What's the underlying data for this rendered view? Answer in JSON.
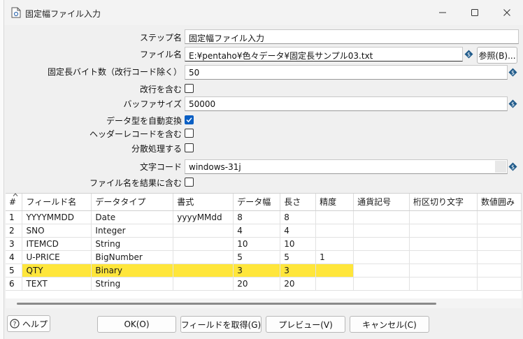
{
  "window": {
    "title": "固定幅ファイル入力"
  },
  "form": {
    "step_name_label": "ステップ名",
    "step_name_value": "固定幅ファイル入力",
    "filename_label": "ファイル名",
    "filename_value": "E:¥pentaho¥色々データ¥固定長サンプル03.txt",
    "browse_label": "参照(B)...",
    "line_width_label": "固定長バイト数（改行コード除く）",
    "line_width_value": "50",
    "line_feed_label": "改行を含む",
    "line_feed_checked": false,
    "buffer_label": "バッファサイズ",
    "buffer_value": "50000",
    "lazy_conv_label": "データ型を自動変換",
    "lazy_conv_checked": true,
    "header_label": "ヘッダーレコードを含む",
    "header_checked": false,
    "parallel_label": "分散処理する",
    "parallel_checked": false,
    "encoding_label": "文字コード",
    "encoding_value": "windows-31j",
    "add_filename_label": "ファイル名を結果に含む",
    "add_filename_checked": false
  },
  "grid": {
    "columns": [
      "#",
      "フィールド名",
      "データタイプ",
      "書式",
      "データ幅",
      "長さ",
      "精度",
      "通貨記号",
      "桁区切り文字",
      "数値囲み"
    ],
    "rows": [
      {
        "n": "1",
        "name": "YYYYMMDD",
        "type": "Date",
        "format": "yyyyMMdd",
        "width": "8",
        "length": "8",
        "precision": "",
        "highlight": false
      },
      {
        "n": "2",
        "name": "SNO",
        "type": "Integer",
        "format": "",
        "width": "4",
        "length": "4",
        "precision": "",
        "highlight": false
      },
      {
        "n": "3",
        "name": "ITEMCD",
        "type": "String",
        "format": "",
        "width": "10",
        "length": "10",
        "precision": "",
        "highlight": false
      },
      {
        "n": "4",
        "name": "U-PRICE",
        "type": "BigNumber",
        "format": "",
        "width": "5",
        "length": "5",
        "precision": "1",
        "highlight": false
      },
      {
        "n": "5",
        "name": "QTY",
        "type": "Binary",
        "format": "",
        "width": "3",
        "length": "3",
        "precision": "",
        "highlight": true
      },
      {
        "n": "6",
        "name": "TEXT",
        "type": "String",
        "format": "",
        "width": "20",
        "length": "20",
        "precision": "",
        "highlight": false
      }
    ],
    "highlight_color": "#ffe63b"
  },
  "footer": {
    "help_label": "ヘルプ",
    "ok_label": "OK(O)",
    "get_fields_label": "フィールドを取得(G)",
    "preview_label": "プレビュー(V)",
    "cancel_label": "キャンセル(C)"
  },
  "colors": {
    "checkbox_on": "#0a5fc4",
    "var_icon": "#1f5a8a"
  }
}
